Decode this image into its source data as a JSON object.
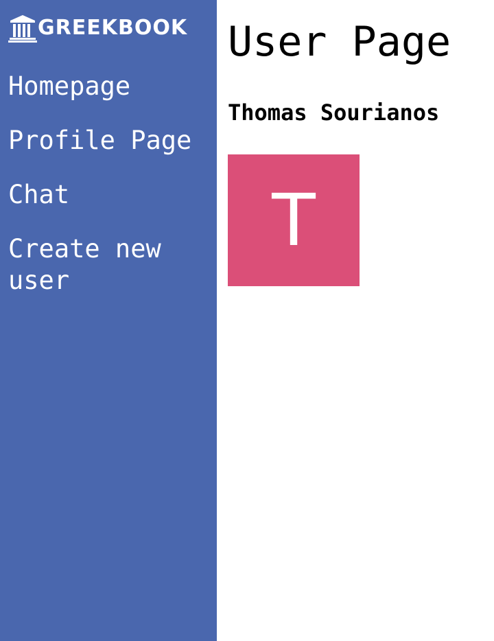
{
  "sidebar": {
    "brand": {
      "icon": "temple-icon",
      "name": "GREEKBOOK"
    },
    "items": [
      {
        "label": "Homepage"
      },
      {
        "label": "Profile Page"
      },
      {
        "label": "Chat"
      },
      {
        "label": "Create new user"
      }
    ]
  },
  "main": {
    "title": "User Page",
    "user": {
      "name": "Thomas Sourianos",
      "avatar_initial": "T"
    }
  },
  "colors": {
    "sidebar_background": "#4a67ae",
    "avatar_background": "#db4f78",
    "page_background": "#ffffff",
    "text": "#000000"
  }
}
